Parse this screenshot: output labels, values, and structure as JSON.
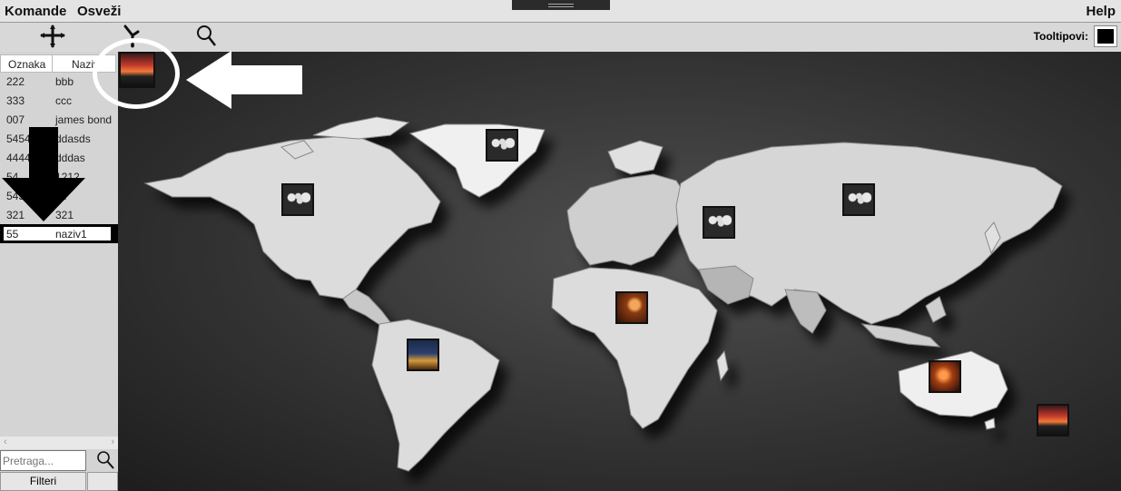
{
  "menu": {
    "commands": "Komande",
    "refresh": "Osveži",
    "help": "Help"
  },
  "toolbar": {
    "add_icon": "move-cross-icon",
    "pin_icon": "pin-icon",
    "search_icon": "magnifier-icon",
    "tooltips_label": "Tooltipovi:"
  },
  "list": {
    "columns": [
      "Oznaka",
      "Naziv"
    ],
    "rows": [
      {
        "code": "222",
        "name": "bbb"
      },
      {
        "code": "333",
        "name": "ccc"
      },
      {
        "code": "007",
        "name": "james bond"
      },
      {
        "code": "5454",
        "name": "ddasds"
      },
      {
        "code": "4444",
        "name": "dddas"
      },
      {
        "code": "54",
        "name": "1212"
      },
      {
        "code": "5454",
        "name": "ffff"
      },
      {
        "code": "321",
        "name": "321"
      },
      {
        "code": "55",
        "name": "naziv1"
      }
    ],
    "selected_index": 8
  },
  "search": {
    "placeholder": "Pretraga...",
    "filters_label": "Filteri",
    "scroll_left": "‹",
    "scroll_right": "›"
  },
  "colors": {
    "map_background": "#2e2e2e",
    "land": "#dcdcdc",
    "selection": "#000000",
    "annotation": "#ffffff"
  }
}
